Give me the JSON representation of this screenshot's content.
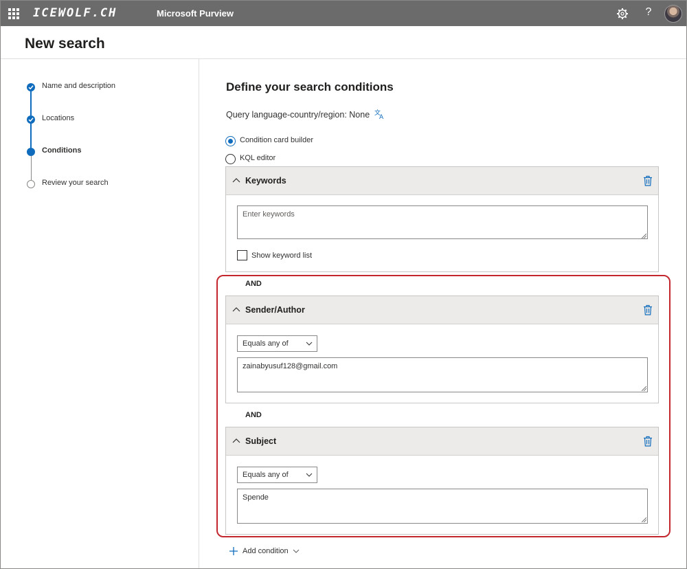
{
  "topbar": {
    "brand": "ICEWOLF.CH",
    "product": "Microsoft Purview",
    "icons": [
      "app-launcher-icon",
      "settings-icon",
      "help-icon",
      "avatar"
    ],
    "help_glyph": "?"
  },
  "header": {
    "title": "New search"
  },
  "stepper": {
    "steps": [
      {
        "label": "Name and description",
        "state": "done"
      },
      {
        "label": "Locations",
        "state": "done"
      },
      {
        "label": "Conditions",
        "state": "current"
      },
      {
        "label": "Review your search",
        "state": "todo"
      }
    ]
  },
  "main": {
    "title": "Define your search conditions",
    "query_language": "Query language-country/region: None",
    "radios": [
      {
        "label": "Condition card builder",
        "selected": true
      },
      {
        "label": "KQL editor",
        "selected": false
      }
    ],
    "keywords_card": {
      "title": "Keywords",
      "input_placeholder": "Enter keywords",
      "checkbox_label": "Show keyword list"
    },
    "operator_1": "AND",
    "sender_card": {
      "title": "Sender/Author",
      "operator": "Equals any of",
      "value": "zainabyusuf128@gmail.com"
    },
    "operator_2": "AND",
    "subject_card": {
      "title": "Subject",
      "operator": "Equals any of",
      "value": "Spende"
    },
    "add_condition": "Add condition"
  },
  "colors": {
    "accent": "#0f6cbd",
    "topbar": "#6b6b6b",
    "highlight": "#c4262e"
  }
}
